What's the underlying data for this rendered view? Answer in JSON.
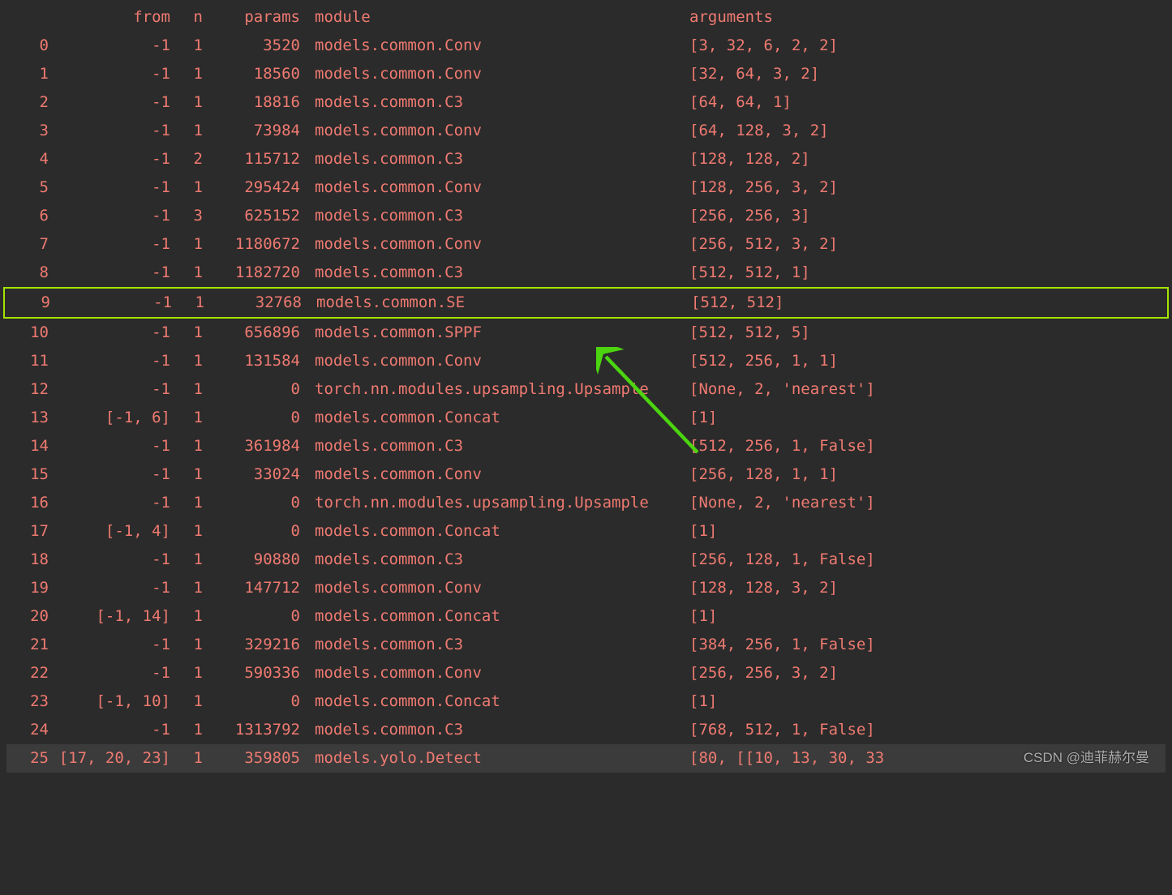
{
  "header": {
    "idx": "",
    "from": "from",
    "n": "n",
    "params": "params",
    "module": "module",
    "arguments": "arguments"
  },
  "rows": [
    {
      "idx": "0",
      "from": "-1",
      "n": "1",
      "params": "3520",
      "module": "models.common.Conv",
      "arguments": "[3, 32, 6, 2, 2]"
    },
    {
      "idx": "1",
      "from": "-1",
      "n": "1",
      "params": "18560",
      "module": "models.common.Conv",
      "arguments": "[32, 64, 3, 2]"
    },
    {
      "idx": "2",
      "from": "-1",
      "n": "1",
      "params": "18816",
      "module": "models.common.C3",
      "arguments": "[64, 64, 1]"
    },
    {
      "idx": "3",
      "from": "-1",
      "n": "1",
      "params": "73984",
      "module": "models.common.Conv",
      "arguments": "[64, 128, 3, 2]"
    },
    {
      "idx": "4",
      "from": "-1",
      "n": "2",
      "params": "115712",
      "module": "models.common.C3",
      "arguments": "[128, 128, 2]"
    },
    {
      "idx": "5",
      "from": "-1",
      "n": "1",
      "params": "295424",
      "module": "models.common.Conv",
      "arguments": "[128, 256, 3, 2]"
    },
    {
      "idx": "6",
      "from": "-1",
      "n": "3",
      "params": "625152",
      "module": "models.common.C3",
      "arguments": "[256, 256, 3]"
    },
    {
      "idx": "7",
      "from": "-1",
      "n": "1",
      "params": "1180672",
      "module": "models.common.Conv",
      "arguments": "[256, 512, 3, 2]"
    },
    {
      "idx": "8",
      "from": "-1",
      "n": "1",
      "params": "1182720",
      "module": "models.common.C3",
      "arguments": "[512, 512, 1]"
    },
    {
      "idx": "9",
      "from": "-1",
      "n": "1",
      "params": "32768",
      "module": "models.common.SE",
      "arguments": "[512, 512]",
      "highlight": true
    },
    {
      "idx": "10",
      "from": "-1",
      "n": "1",
      "params": "656896",
      "module": "models.common.SPPF",
      "arguments": "[512, 512, 5]"
    },
    {
      "idx": "11",
      "from": "-1",
      "n": "1",
      "params": "131584",
      "module": "models.common.Conv",
      "arguments": "[512, 256, 1, 1]"
    },
    {
      "idx": "12",
      "from": "-1",
      "n": "1",
      "params": "0",
      "module": "torch.nn.modules.upsampling.Upsample",
      "arguments": "[None, 2, 'nearest']"
    },
    {
      "idx": "13",
      "from": "[-1, 6]",
      "n": "1",
      "params": "0",
      "module": "models.common.Concat",
      "arguments": "[1]"
    },
    {
      "idx": "14",
      "from": "-1",
      "n": "1",
      "params": "361984",
      "module": "models.common.C3",
      "arguments": "[512, 256, 1, False]"
    },
    {
      "idx": "15",
      "from": "-1",
      "n": "1",
      "params": "33024",
      "module": "models.common.Conv",
      "arguments": "[256, 128, 1, 1]"
    },
    {
      "idx": "16",
      "from": "-1",
      "n": "1",
      "params": "0",
      "module": "torch.nn.modules.upsampling.Upsample",
      "arguments": "[None, 2, 'nearest']"
    },
    {
      "idx": "17",
      "from": "[-1, 4]",
      "n": "1",
      "params": "0",
      "module": "models.common.Concat",
      "arguments": "[1]"
    },
    {
      "idx": "18",
      "from": "-1",
      "n": "1",
      "params": "90880",
      "module": "models.common.C3",
      "arguments": "[256, 128, 1, False]"
    },
    {
      "idx": "19",
      "from": "-1",
      "n": "1",
      "params": "147712",
      "module": "models.common.Conv",
      "arguments": "[128, 128, 3, 2]"
    },
    {
      "idx": "20",
      "from": "[-1, 14]",
      "n": "1",
      "params": "0",
      "module": "models.common.Concat",
      "arguments": "[1]"
    },
    {
      "idx": "21",
      "from": "-1",
      "n": "1",
      "params": "329216",
      "module": "models.common.C3",
      "arguments": "[384, 256, 1, False]"
    },
    {
      "idx": "22",
      "from": "-1",
      "n": "1",
      "params": "590336",
      "module": "models.common.Conv",
      "arguments": "[256, 256, 3, 2]"
    },
    {
      "idx": "23",
      "from": "[-1, 10]",
      "n": "1",
      "params": "0",
      "module": "models.common.Concat",
      "arguments": "[1]"
    },
    {
      "idx": "24",
      "from": "-1",
      "n": "1",
      "params": "1313792",
      "module": "models.common.C3",
      "arguments": "[768, 512, 1, False]"
    },
    {
      "idx": "25",
      "from": "[17, 20, 23]",
      "n": "1",
      "params": "359805",
      "module": "models.yolo.Detect",
      "arguments": "[80, [[10, 13, 30, 33",
      "selected": true
    }
  ],
  "watermark": "CSDN @迪菲赫尔曼"
}
